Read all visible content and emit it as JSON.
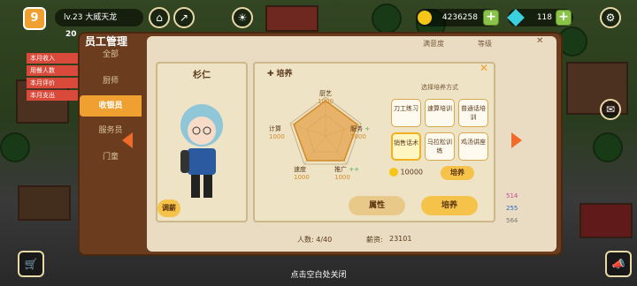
{
  "hud": {
    "level_badge": "9",
    "player": "lv.23 大威天龙",
    "gold": "4236258",
    "gems": "118",
    "left_partial": "20"
  },
  "info_list": [
    "本月收入",
    "用餐人数",
    "本月评价",
    "本月支出"
  ],
  "panel": {
    "title": "员工管理",
    "filters": [
      "满意度",
      "等级"
    ],
    "tabs": [
      "全部",
      "厨师",
      "收银员",
      "服务员",
      "门童"
    ],
    "active_tab": 2,
    "headcount": "人数: 4/40",
    "salary_label": "薪资:",
    "salary_value": "23101",
    "peek_stats": [
      "514",
      "255",
      "564"
    ]
  },
  "staff": {
    "name": "杉仁",
    "adjust_salary": "调薪"
  },
  "train": {
    "title": "培养",
    "radar": {
      "axes": [
        "厨艺",
        "服务",
        "推广",
        "速度",
        "计算"
      ],
      "values": [
        "1000",
        "1000",
        "1000",
        "1000",
        "1000"
      ],
      "marks": [
        "",
        "+",
        "++",
        "",
        ""
      ]
    },
    "method_title": "选择培养方式",
    "methods": [
      "刀工练习",
      "速算培训",
      "普通话培训",
      "销售话术",
      "马拉松训练",
      "鸡汤讲座"
    ],
    "selected": 3,
    "cost": "10000",
    "small_train_label": "培养",
    "attr_button": "属性",
    "train_button": "培养",
    "close": "✕"
  },
  "footer_hint": "点击空白处关闭",
  "colors": {
    "accent": "#f0a030",
    "panel": "#6b3d1e",
    "paper": "#efe3c6"
  }
}
